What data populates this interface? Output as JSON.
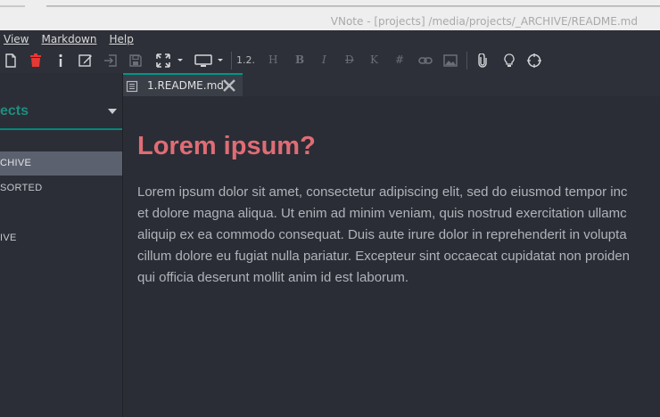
{
  "window": {
    "title": "VNote - [projects] /media/projects/_ARCHIVE/README.md"
  },
  "menubar": {
    "items": [
      {
        "label": "View"
      },
      {
        "label": "Markdown"
      },
      {
        "label": "Help"
      }
    ]
  },
  "toolbar": {
    "heading_level": "1.2.",
    "header_glyph": "H",
    "bold_glyph": "B",
    "italic_glyph": "I",
    "strike_glyph": "D",
    "code_glyph": "K",
    "hash_glyph": "#",
    "colors": {
      "delete_icon": "#e53935",
      "icon": "#d4d6d9",
      "disabled": "#6c6f77"
    }
  },
  "sidebar": {
    "notebook": "ects",
    "folders": [
      {
        "label": "CHIVE",
        "selected": true
      },
      {
        "label": "SORTED",
        "selected": false
      },
      {
        "label": "IVE",
        "selected": false
      }
    ],
    "accent": "#00897b"
  },
  "tabs": [
    {
      "label": "1.README.md",
      "active": true
    }
  ],
  "document": {
    "heading": "Lorem ipsum?",
    "heading_color": "#e06c75",
    "paragraph_lines": [
      "Lorem ipsum dolor sit amet, consectetur adipiscing elit, sed do eiusmod tempor inc",
      "et dolore magna aliqua. Ut enim ad minim veniam, quis nostrud exercitation ullamc",
      "aliquip ex ea commodo consequat. Duis aute irure dolor in reprehenderit in volupta",
      "cillum dolore eu fugiat nulla pariatur. Excepteur sint occaecat cupidatat non proiden",
      "qui officia deserunt mollit anim id est laborum."
    ]
  }
}
